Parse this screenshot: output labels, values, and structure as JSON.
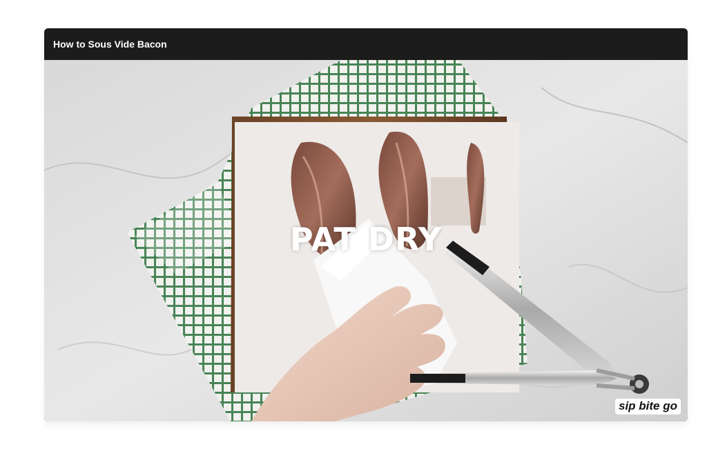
{
  "player": {
    "title": "How to Sous Vide Bacon"
  },
  "video": {
    "overlay_caption": "PAT DRY",
    "watermark": "sip bite go"
  }
}
